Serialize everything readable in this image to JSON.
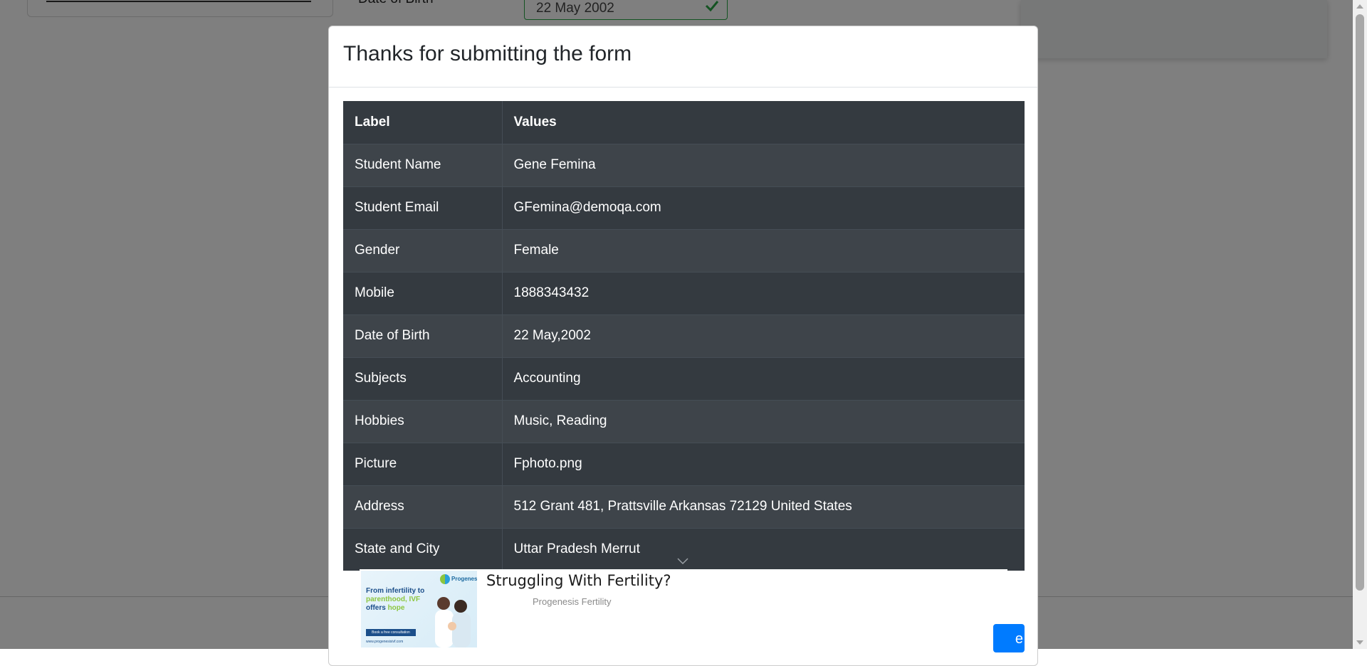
{
  "background": {
    "dob_label": "Date of Birth",
    "dob_value": "22 May 2002"
  },
  "modal": {
    "title": "Thanks for submitting the form",
    "table": {
      "headers": [
        "Label",
        "Values"
      ],
      "rows": [
        {
          "label": "Student Name",
          "value": "Gene Femina"
        },
        {
          "label": "Student Email",
          "value": "GFemina@demoqa.com"
        },
        {
          "label": "Gender",
          "value": "Female"
        },
        {
          "label": "Mobile",
          "value": "1888343432"
        },
        {
          "label": "Date of Birth",
          "value": "22 May,2002"
        },
        {
          "label": "Subjects",
          "value": "Accounting"
        },
        {
          "label": "Hobbies",
          "value": "Music, Reading"
        },
        {
          "label": "Picture",
          "value": "Fphoto.png"
        },
        {
          "label": "Address",
          "value": "512 Grant 481, Prattsville Arkansas 72129 United States"
        },
        {
          "label": "State and City",
          "value": "Uttar Pradesh Merrut"
        }
      ]
    },
    "close_label_visible": "e"
  },
  "ad": {
    "headline": "Struggling With Fertility?",
    "advertiser": "Progenesis Fertility",
    "image": {
      "brand": "Progenesis",
      "tagline_1": "From infertility to",
      "tagline_2": "parenthood, IVF",
      "tagline_3a": "offers ",
      "tagline_3b": "hope",
      "cta": "Book a free consultation",
      "url": "www.progenesisivf.com"
    }
  },
  "colors": {
    "table_dark": "#343a40",
    "table_striped": "#3e444a",
    "primary_button": "#007bff",
    "valid_green": "#28a745"
  }
}
